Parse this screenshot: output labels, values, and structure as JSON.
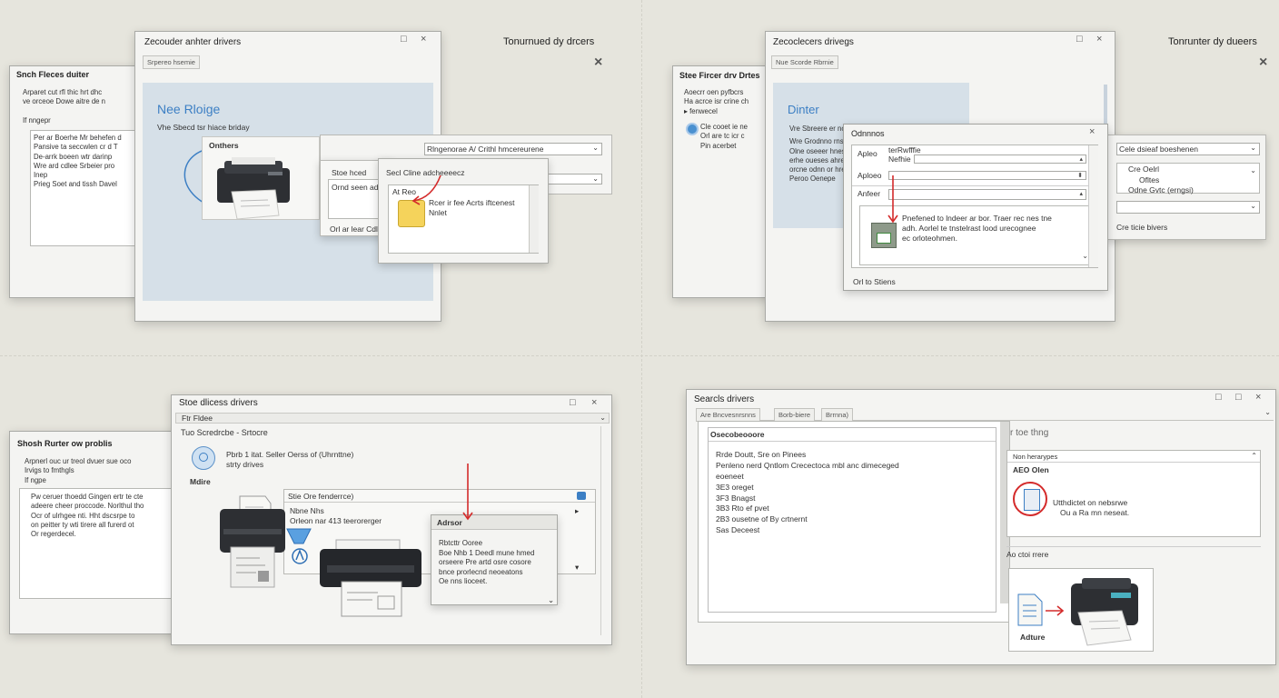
{
  "q1": {
    "bg_title": "Snch Fleces duiter",
    "bg_lines": [
      "Arparet cut rfl thic hrt dhc",
      "ve orceoe Dowe aitre de n",
      "If nngepr"
    ],
    "bg_list": [
      "Per ar Boerhe Mr behefen d",
      "Pansive ta seccwlen cr d T",
      "De-arrk boeen wtr darinp",
      "Wre ard cdlee Srbeier pro",
      "Inep",
      "Prieg Soet and tissh Davel"
    ],
    "main_title": "Zecouder anhter drivers",
    "tab": "Srpereo hsemie",
    "headline": "Nee Rloige",
    "subline": "Vhe Sbecd tsr hiace briday",
    "card_label": "Onthers",
    "dropdown": "Rlngenorae A/ Crithl hmcereurene",
    "sub_title": "Stoe hced",
    "sub_line": "Ornd seen ado",
    "sub_footer": "Orl ar lear Cdle",
    "popup_title": "Secl Cline adcheeeecz",
    "popup_box_label": "At Reo",
    "popup_lines": [
      "Rcer ir fee Acrts iftcenest",
      "Nnlet"
    ],
    "side_title": "Tonurnued dy drcers"
  },
  "q2": {
    "bg_title": "Stee Fircer drv Drtes",
    "bg_lines": [
      "Aoecrr oen pyfbcrs",
      "Ha acrce isr crine ch",
      "▸ fenwecel"
    ],
    "bg_list": [
      "Cle cooet ie ne",
      "Orl are tc icr c",
      "Pin acerbet"
    ],
    "main_title": "Zecoclecers drivegs",
    "tab": "Nue Scorde Rbrnie",
    "headline": "Dinter",
    "blue_lines": [
      "Vre Sbreere er nc",
      "Wre Grodnno rnsn",
      "Olne oseeer hnes",
      "erhe oueses ahre",
      "orcne odnn or hre",
      "Peroo Oenepe"
    ],
    "dialog_title": "Odnnnos",
    "row_labels": [
      "Apleo",
      "Aploeo",
      "Anfeer"
    ],
    "row_values": [
      "terRwfffie",
      "Nefhie"
    ],
    "inner_text": [
      "Pnefened to lndeer ar bor. Traer rec nes tne",
      "adh. Aorlel te tnstelrast lood urecognee",
      "ec orloteohmen."
    ],
    "dialog_footer": "Orl to Stiens",
    "right_dropdown": "Cele dsieaf boeshenen",
    "right_list": [
      "Cre Oelrl",
      "Ofltes",
      "Odne Gvtc (erngsi)"
    ],
    "right_footer": "Cre ticie bivers",
    "side_title": "Tonrunter dy dueers"
  },
  "q3": {
    "bg_title": "Shosh Rurter ow problis",
    "bg_lines": [
      "Arpnerl ouc ur treol dvuer sue oco",
      "Irvigs to fmthgls",
      "If ngpe"
    ],
    "bg_list": [
      "Pw ceruer thoedd Gingen ertr te cte",
      "adeere cheer proccode. Norlthul tho",
      "Ocr of ulrhgee nti. Hht dscsrpe to",
      "on peitter ty wti tirere all furerd ot",
      "Or regerdecel."
    ],
    "main_title": "Stoe dlicess drivers",
    "menu": "Ftr Fldee",
    "breadcrumb": "Tuo Scredrcbe - Srtocre",
    "hdr_lines": [
      "Pbrb 1 itat. Seller Oerss of (Uhrnttne)",
      "strty drives"
    ],
    "icon_label": "Mdire",
    "panel_title": "Stie Ore fenderrce)",
    "panel_lines": [
      "Nbne Nhs",
      "Orleon nar 413 teerorerger"
    ],
    "adv_title": "Adrsor",
    "adv_lines": [
      "Rbtcttr Ooree",
      "Boe Nhb 1 Deedl mune hmed",
      "orseere Pre artd osre cosore",
      "bnce prorlecnd neoeatons",
      "Oe nns lioceet."
    ]
  },
  "q4": {
    "main_title": "Searcls drivers",
    "tabs": [
      "Are   Bncvesnrsnns",
      "Borb-biere",
      "Brrnna)"
    ],
    "list_header": "Osecobeooore",
    "list_lines": [
      "Rrde Doutt, Sre on Pinees",
      "Penleno nerd Qntlom Crecectoca mbl anc dimeceged",
      "eoeneet",
      "3E3 oreget",
      "3F3 Bnagst",
      "3B3 Rto ef pvet",
      "2B3 ousetne of By crtnernt",
      "Sas Deceest"
    ],
    "right_title": "r toe thng",
    "right_sub": "Non herarypes",
    "right_bold": "AEO Olen",
    "right_lines": [
      "Utthdictet on nebsrwe",
      "Ou a Ra mn neseat."
    ],
    "right_section": "Ao ctoi rrere",
    "printer_label": "Adture"
  }
}
